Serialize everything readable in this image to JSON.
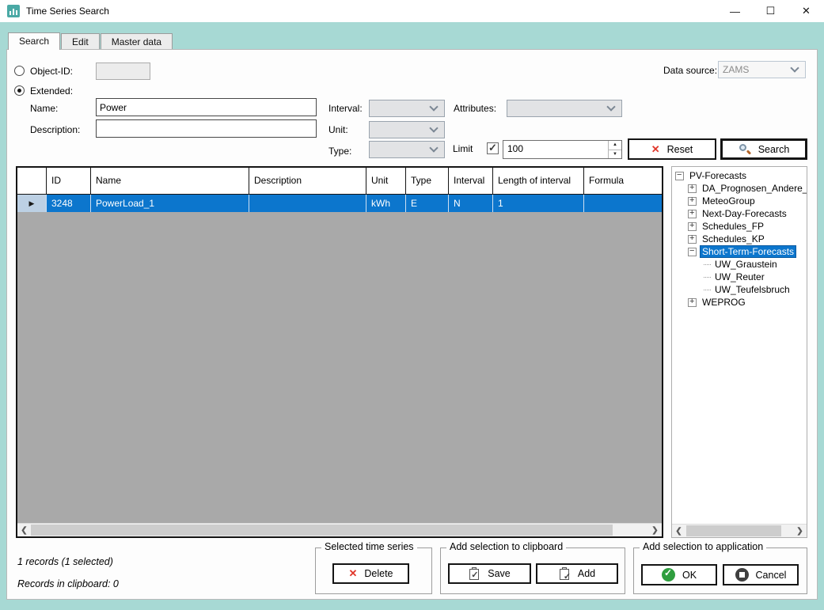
{
  "window": {
    "title": "Time Series Search",
    "minimize_glyph": "—",
    "maximize_glyph": "☐",
    "close_glyph": "✕"
  },
  "tabs": [
    {
      "label": "Search",
      "active": true
    },
    {
      "label": "Edit",
      "active": false
    },
    {
      "label": "Master data",
      "active": false
    }
  ],
  "form": {
    "object_id_label": "Object-ID:",
    "object_id_value": "",
    "extended_label": "Extended:",
    "name_label": "Name:",
    "name_value": "Power",
    "description_label": "Description:",
    "description_value": "",
    "interval_label": "Interval:",
    "interval_value": "",
    "unit_label": "Unit:",
    "unit_value": "",
    "type_label": "Type:",
    "type_value": "",
    "attributes_label": "Attributes:",
    "attributes_value": "",
    "data_source_label": "Data source:",
    "data_source_value": "ZAMS",
    "limit_label": "Limit",
    "limit_checked": true,
    "limit_value": "100",
    "reset_label": "Reset",
    "search_label": "Search"
  },
  "table": {
    "columns": [
      "ID",
      "Name",
      "Description",
      "Unit",
      "Type",
      "Interval",
      "Length of interval",
      "Formula"
    ],
    "rows": [
      {
        "id": "3248",
        "name": "PowerLoad_1",
        "description": "",
        "unit": "kWh",
        "type": "E",
        "interval": "N",
        "length_of_interval": "1",
        "formula": "",
        "selected": true
      }
    ]
  },
  "tree": {
    "items": [
      {
        "label": "PV-Forecasts",
        "level": 0,
        "expander": "minus",
        "selected": false
      },
      {
        "label": "DA_Prognosen_Andere_",
        "level": 1,
        "expander": "plus",
        "selected": false
      },
      {
        "label": "MeteoGroup",
        "level": 1,
        "expander": "plus",
        "selected": false
      },
      {
        "label": "Next-Day-Forecasts",
        "level": 1,
        "expander": "plus",
        "selected": false
      },
      {
        "label": "Schedules_FP",
        "level": 1,
        "expander": "plus",
        "selected": false
      },
      {
        "label": "Schedules_KP",
        "level": 1,
        "expander": "plus",
        "selected": false
      },
      {
        "label": "Short-Term-Forecasts",
        "level": 1,
        "expander": "minus",
        "selected": true
      },
      {
        "label": "UW_Graustein",
        "level": 2,
        "expander": "none",
        "selected": false
      },
      {
        "label": "UW_Reuter",
        "level": 2,
        "expander": "none",
        "selected": false
      },
      {
        "label": "UW_Teufelsbruch",
        "level": 2,
        "expander": "none",
        "selected": false
      },
      {
        "label": "WEPROG",
        "level": 1,
        "expander": "plus",
        "selected": false
      }
    ]
  },
  "status": {
    "records": "1 records (1 selected)",
    "clipboard": "Records in clipboard: 0"
  },
  "groups": {
    "selected_series": {
      "title": "Selected time series",
      "delete_label": "Delete"
    },
    "clipboard": {
      "title": "Add selection to clipboard",
      "save_label": "Save",
      "add_label": "Add"
    },
    "application": {
      "title": "Add selection to application",
      "ok_label": "OK",
      "cancel_label": "Cancel"
    }
  },
  "colors": {
    "background_teal": "#a7d9d4",
    "selection_blue": "#0c76cd",
    "grid_empty_gray": "#a9a9a9",
    "delete_red": "#e0372b",
    "ok_green": "#2f9e3f",
    "titlebar_white": "#ffffff"
  }
}
